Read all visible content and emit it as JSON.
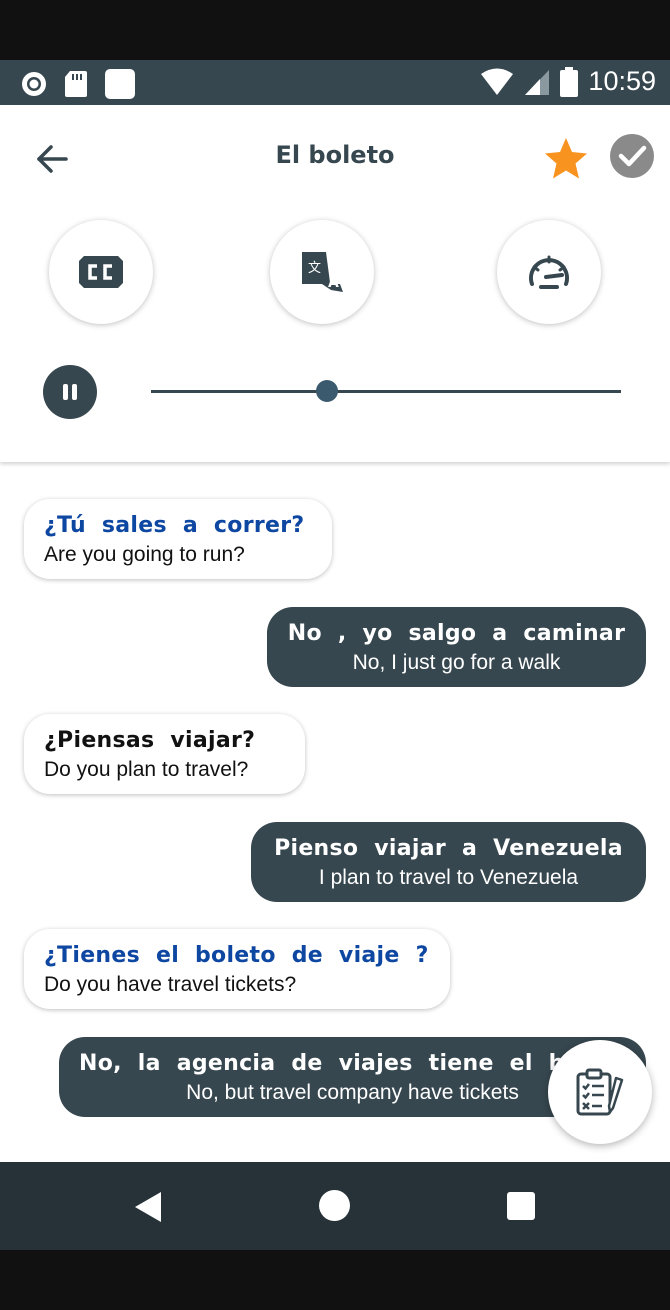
{
  "status_bar": {
    "time": "10:59"
  },
  "header": {
    "title": "El boleto"
  },
  "player": {
    "progress": 0.375
  },
  "messages": [
    {
      "side": "left",
      "spanish": "¿Tú sales a correr?",
      "english": "Are you going to run?",
      "color": "#0d47a1"
    },
    {
      "side": "right",
      "spanish": "No , yo salgo a caminar",
      "english": "No, I just go for a walk",
      "color": "#37474f"
    },
    {
      "side": "left",
      "spanish": "¿Piensas viajar?",
      "english": "Do you plan to travel?",
      "color": "#111111"
    },
    {
      "side": "right",
      "spanish": "Pienso viajar a Venezuela",
      "english": "I plan to travel to Venezuela",
      "color": "#37474f"
    },
    {
      "side": "left",
      "spanish": "¿Tienes el boleto de viaje ?",
      "english": "Do you have travel tickets?",
      "color": "#0d47a1"
    },
    {
      "side": "right",
      "spanish": "No, la agencia de viajes tiene el boleto",
      "english": "No, but travel company have tickets",
      "color": "#37474f"
    }
  ],
  "icons": {
    "back": "arrow-left-icon",
    "favorite": "star-icon",
    "done": "check-circle-icon",
    "captions": "closed-captions-icon",
    "translate": "translate-icon",
    "speed": "speedometer-icon",
    "pause": "pause-icon",
    "quiz": "clipboard-checklist-icon"
  },
  "colors": {
    "primary_dark": "#37474f",
    "accent_star": "#f7931e",
    "spanish_blue": "#0d47a1",
    "done_gray": "#8a8a8a"
  }
}
